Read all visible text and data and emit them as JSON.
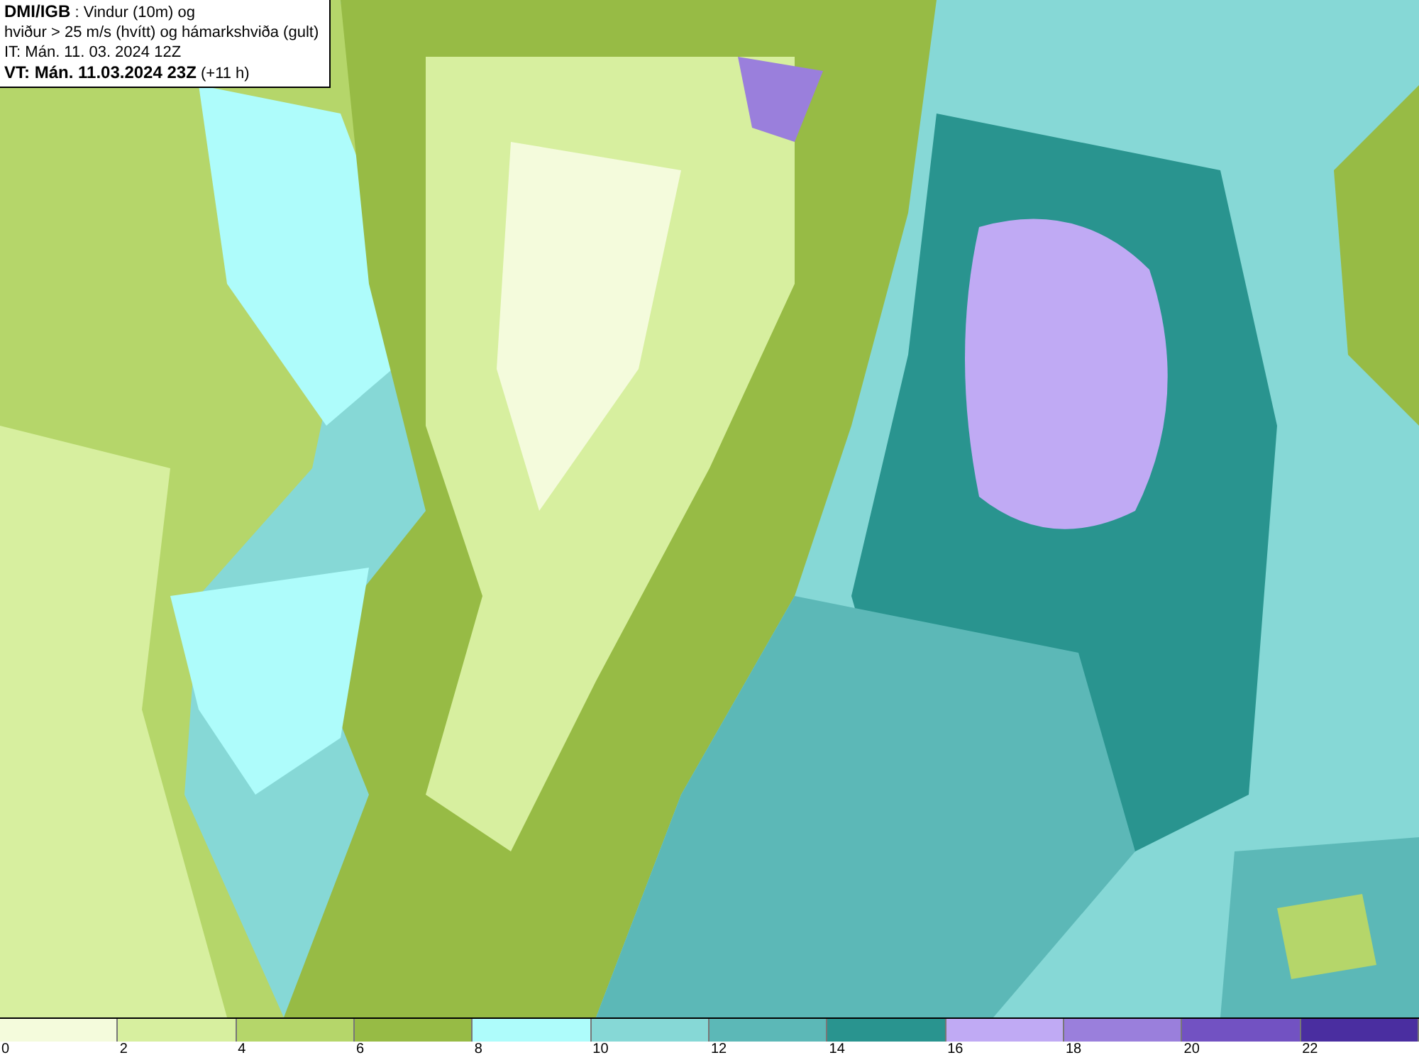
{
  "header": {
    "source": "DMI/IGB",
    "title_rest": " : Vindur (10m) og",
    "line_2": "hviður > 25 m/s (hvítt) og hámarkshviða (gult)",
    "issue_time": "IT: Mán. 11. 03. 2024 12Z",
    "valid_time": "VT: Mán. 11.03.2024 23Z",
    "lead": " (+11 h)"
  },
  "legend": [
    {
      "label": "0",
      "color": "#f4fbdc"
    },
    {
      "label": "2",
      "color": "#d7ef9f"
    },
    {
      "label": "4",
      "color": "#b5d66a"
    },
    {
      "label": "6",
      "color": "#97bb45"
    },
    {
      "label": "8",
      "color": "#aefcfb"
    },
    {
      "label": "10",
      "color": "#86d8d6"
    },
    {
      "label": "12",
      "color": "#5cb8b7"
    },
    {
      "label": "14",
      "color": "#29948f"
    },
    {
      "label": "16",
      "color": "#c0aaf4"
    },
    {
      "label": "18",
      "color": "#9a7fdc"
    },
    {
      "label": "20",
      "color": "#7252c2"
    },
    {
      "label": "22",
      "color": "#4a2ea0"
    }
  ]
}
